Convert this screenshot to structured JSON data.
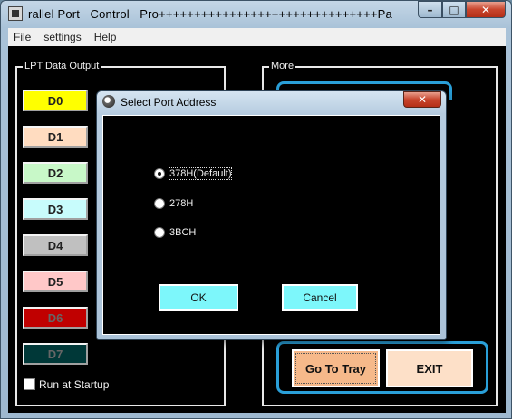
{
  "window": {
    "title": "rallel Port   Control   Pro+++++++++++++++++++++++++++++++Pa",
    "caption": {
      "minimize": "–",
      "maximize": "□",
      "close": "✕"
    }
  },
  "menu": {
    "file": "File",
    "settings": "settings",
    "help": "Help"
  },
  "lpt": {
    "group_label": "LPT Data Output",
    "buttons": [
      {
        "label": "D0",
        "color": "#ffff00"
      },
      {
        "label": "D1",
        "color": "#ffdcc0"
      },
      {
        "label": "D2",
        "color": "#c8f8c8"
      },
      {
        "label": "D3",
        "color": "#c8fcfc"
      },
      {
        "label": "D4",
        "color": "#c0c0c0"
      },
      {
        "label": "D5",
        "color": "#ffc8c8"
      },
      {
        "label": "D6",
        "color": "#c00000"
      },
      {
        "label": "D7",
        "color": "#003838"
      }
    ],
    "run_at_startup": {
      "label": "Run at Startup",
      "checked": false
    }
  },
  "more": {
    "group_label": "More",
    "go_to_tray": "Go To Tray",
    "exit": "EXIT"
  },
  "dialog": {
    "title": "Select Port Address",
    "close": "✕",
    "options": [
      {
        "label": "378H(Default)",
        "checked": true
      },
      {
        "label": "278H",
        "checked": false
      },
      {
        "label": "3BCH",
        "checked": false
      }
    ],
    "ok": "OK",
    "cancel": "Cancel"
  }
}
